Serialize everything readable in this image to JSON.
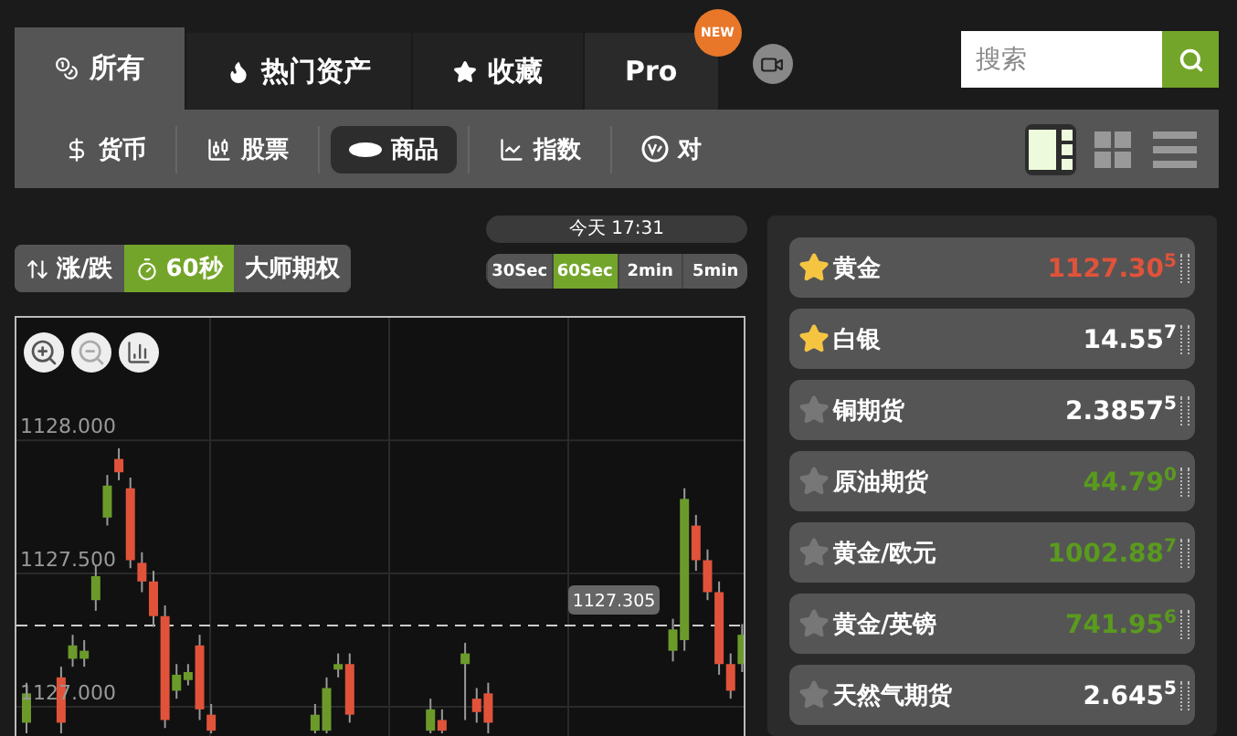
{
  "top_tabs": [
    {
      "label": "所有",
      "selected": true
    },
    {
      "label": "热门资产",
      "selected": false
    },
    {
      "label": "收藏",
      "selected": false
    },
    {
      "label": "Pro",
      "selected": false,
      "badge": "NEW"
    }
  ],
  "search": {
    "placeholder": "搜索"
  },
  "categories": [
    {
      "label": "货币",
      "selected": false
    },
    {
      "label": "股票",
      "selected": false
    },
    {
      "label": "商品",
      "selected": true
    },
    {
      "label": "指数",
      "selected": false
    },
    {
      "label": "对",
      "selected": false
    }
  ],
  "view_modes": [
    {
      "kind": "split",
      "selected": true
    },
    {
      "kind": "grid",
      "selected": false
    },
    {
      "kind": "list",
      "selected": false
    }
  ],
  "option_types": [
    {
      "label": "涨/跌",
      "selected": false
    },
    {
      "label": "60秒",
      "selected": true
    },
    {
      "label": "大师期权",
      "selected": false
    }
  ],
  "time_label": "今天 17:31",
  "intervals": [
    {
      "label": "30Sec",
      "selected": false
    },
    {
      "label": "60Sec",
      "selected": true
    },
    {
      "label": "2min",
      "selected": false
    },
    {
      "label": "5min",
      "selected": false
    }
  ],
  "chart": {
    "chart_data": {
      "type": "candlestick",
      "categories": [
        null,
        null,
        null,
        null,
        null,
        null,
        null,
        null,
        null,
        null,
        null,
        null,
        null,
        null,
        null,
        null,
        null,
        null,
        null,
        null,
        null,
        null,
        null,
        null,
        null,
        null,
        null,
        null,
        null,
        null,
        null,
        null,
        null,
        null,
        null,
        null,
        null,
        null,
        null,
        null,
        null,
        null,
        null,
        null,
        null,
        null,
        null,
        null,
        null,
        null,
        null,
        null,
        null,
        null,
        null,
        null,
        null,
        null,
        null,
        null,
        null,
        null,
        null
      ],
      "ohlc": [
        [
          1126.94,
          1127.09,
          1126.9,
          1127.05
        ],
        null,
        null,
        [
          1127.11,
          1127.15,
          1126.9,
          1126.94
        ],
        [
          1127.18,
          1127.27,
          1127.15,
          1127.23
        ],
        [
          1127.18,
          1127.25,
          1127.15,
          1127.21
        ],
        [
          1127.4,
          1127.53,
          1127.36,
          1127.49
        ],
        [
          1127.71,
          1127.87,
          1127.68,
          1127.83
        ],
        [
          1127.93,
          1127.97,
          1127.85,
          1127.88
        ],
        [
          1127.82,
          1127.86,
          1127.52,
          1127.55
        ],
        [
          1127.54,
          1127.58,
          1127.43,
          1127.47
        ],
        [
          1127.47,
          1127.51,
          1127.3,
          1127.34
        ],
        [
          1127.34,
          1127.38,
          1126.92,
          1126.95
        ],
        [
          1127.06,
          1127.16,
          1127.03,
          1127.12
        ],
        [
          1127.1,
          1127.16,
          1127.08,
          1127.13
        ],
        [
          1127.23,
          1127.27,
          1126.95,
          1126.99
        ],
        [
          1126.97,
          1127.01,
          1126.9,
          1126.91
        ],
        null,
        null,
        null,
        null,
        null,
        null,
        null,
        null,
        [
          1126.91,
          1127.01,
          1126.9,
          1126.97
        ],
        [
          1126.91,
          1127.11,
          1126.9,
          1127.07
        ],
        [
          1127.14,
          1127.2,
          1127.11,
          1127.16
        ],
        [
          1127.16,
          1127.2,
          1126.94,
          1126.97
        ],
        null,
        null,
        null,
        null,
        null,
        null,
        [
          1126.91,
          1127.03,
          1126.9,
          1126.99
        ],
        [
          1126.95,
          1126.99,
          1126.9,
          1126.91
        ],
        null,
        [
          1127.16,
          1127.24,
          1126.95,
          1127.2
        ],
        [
          1127.03,
          1127.07,
          1126.94,
          1126.98
        ],
        [
          1127.05,
          1127.09,
          1126.9,
          1126.94
        ],
        null,
        null,
        null,
        null,
        null,
        null,
        null,
        null,
        null,
        null,
        null,
        null,
        null,
        null,
        null,
        [
          1127.21,
          1127.33,
          1127.17,
          1127.29
        ],
        [
          1127.25,
          1127.82,
          1127.21,
          1127.78
        ],
        [
          1127.68,
          1127.72,
          1127.51,
          1127.55
        ],
        [
          1127.55,
          1127.59,
          1127.4,
          1127.43
        ],
        [
          1127.43,
          1127.47,
          1127.12,
          1127.16
        ],
        [
          1127.16,
          1127.2,
          1127.03,
          1127.06
        ],
        [
          1127.16,
          1127.31,
          1127.13,
          1127.27
        ]
      ],
      "ylim": [
        1126.89,
        1128.46
      ],
      "grid": true,
      "yticks": [
        {
          "value": 1128,
          "label": "1128.000"
        },
        {
          "value": 1127.5,
          "label": "1127.500"
        },
        {
          "value": 1127,
          "label": "1127.000"
        }
      ],
      "ref_lines": [
        {
          "axis": "y",
          "value": 1127.305,
          "label": "1127.305"
        }
      ]
    }
  },
  "assets": [
    {
      "name": "黄金",
      "favorite": true,
      "color": "#e0533a",
      "price": "1127.30",
      "digit": "5"
    },
    {
      "name": "白银",
      "favorite": true,
      "color": "#ffffff",
      "price": "14.55",
      "digit": "7"
    },
    {
      "name": "铜期货",
      "favorite": false,
      "color": "#ffffff",
      "price": "2.3857",
      "digit": "5"
    },
    {
      "name": "原油期货",
      "favorite": false,
      "color": "#5a9a1e",
      "price": "44.79",
      "digit": "0"
    },
    {
      "name": "黄金/欧元",
      "favorite": false,
      "color": "#5a9a1e",
      "price": "1002.88",
      "digit": "7"
    },
    {
      "name": "黄金/英镑",
      "favorite": false,
      "color": "#5a9a1e",
      "price": "741.95",
      "digit": "6"
    },
    {
      "name": "天然气期货",
      "favorite": false,
      "color": "#ffffff",
      "price": "2.645",
      "digit": "5"
    }
  ]
}
